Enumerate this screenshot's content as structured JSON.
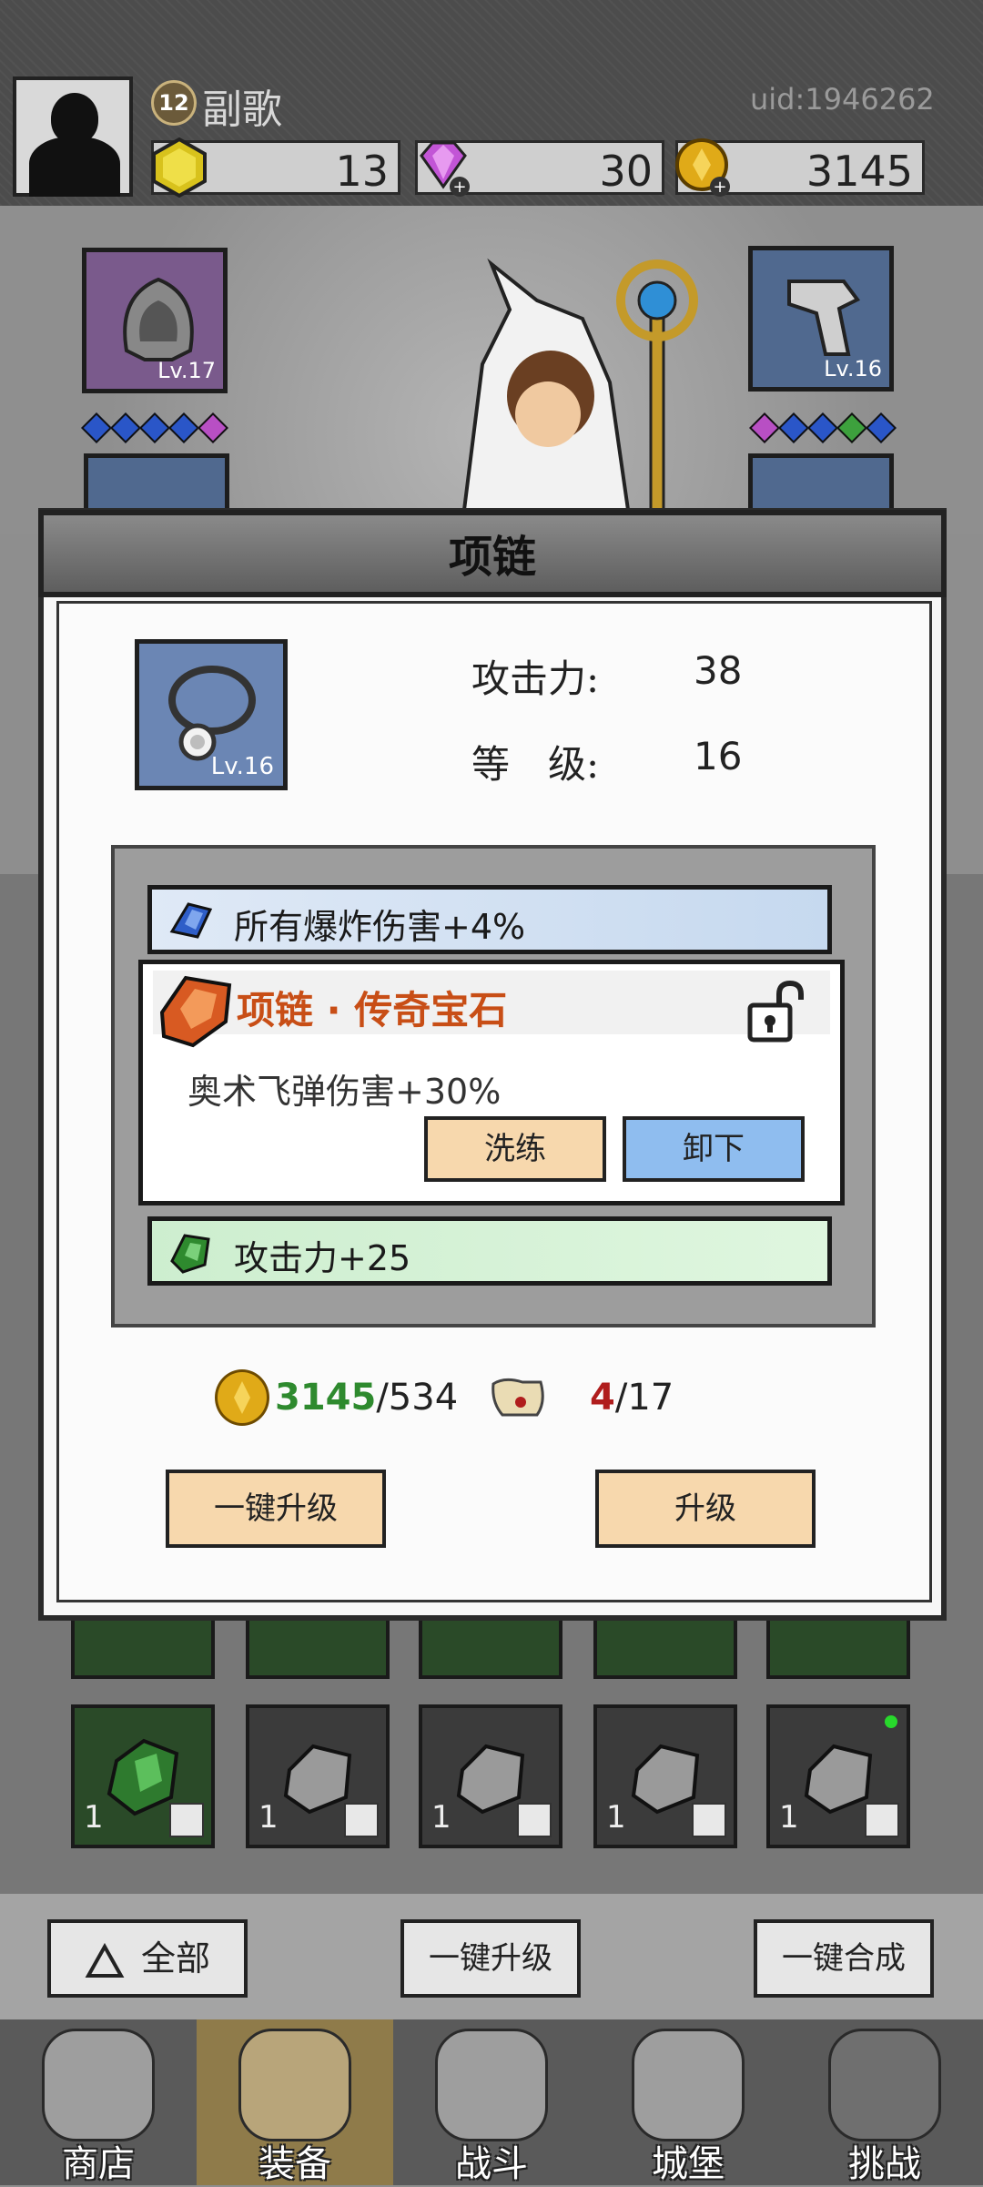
{
  "player": {
    "level": "12",
    "name": "副歌",
    "uid": "uid:1946262"
  },
  "resources": [
    {
      "name": "gold-gem",
      "value": "13",
      "icon": "yellow-gem-icon"
    },
    {
      "name": "diamond",
      "value": "30",
      "icon": "pink-diamond-icon"
    },
    {
      "name": "coin",
      "value": "3145",
      "icon": "gold-coin-icon"
    }
  ],
  "equip_slots": {
    "left_top": {
      "level": "Lv.17",
      "icon": "hood-icon"
    },
    "right_top": {
      "level": "Lv.16",
      "icon": "boots-icon"
    }
  },
  "modal": {
    "title": "项链",
    "item_icon": "necklace-icon",
    "item_level": "Lv.16",
    "attack_label": "攻击力:",
    "attack_value": "38",
    "level_label": "等　级:",
    "level_value": "16",
    "gem_top_text": "所有爆炸伤害+4%",
    "legend_title": "项链 · 传奇宝石",
    "legend_desc": "奥术飞弹伤害+30%",
    "reroll_label": "洗练",
    "unequip_label": "卸下",
    "gem_bottom_text": "攻击力+25",
    "coin_have": "3145",
    "coin_need": "/534",
    "scroll_have": "4",
    "scroll_need": "/17",
    "upgrade_all_label": "一键升级",
    "upgrade_label": "升级"
  },
  "bag": {
    "counts": [
      "1",
      "1",
      "1",
      "1",
      "1"
    ]
  },
  "controls": {
    "filter_label": "全部",
    "upgrade_all_label": "一键升级",
    "merge_all_label": "一键合成"
  },
  "nav": [
    {
      "label": "商店",
      "icon": "shop-icon"
    },
    {
      "label": "装备",
      "icon": "backpack-icon"
    },
    {
      "label": "战斗",
      "icon": "crossed-swords-icon"
    },
    {
      "label": "城堡",
      "icon": "castle-icon"
    },
    {
      "label": "挑战",
      "icon": "challenge-lock-icon"
    }
  ],
  "colors": {
    "legend_orange": "#c84e16",
    "coin_green": "#2e8a2e",
    "scroll_red": "#b01d1d",
    "blue_button": "#8fbdef",
    "tan_button": "#f7d8ad"
  }
}
